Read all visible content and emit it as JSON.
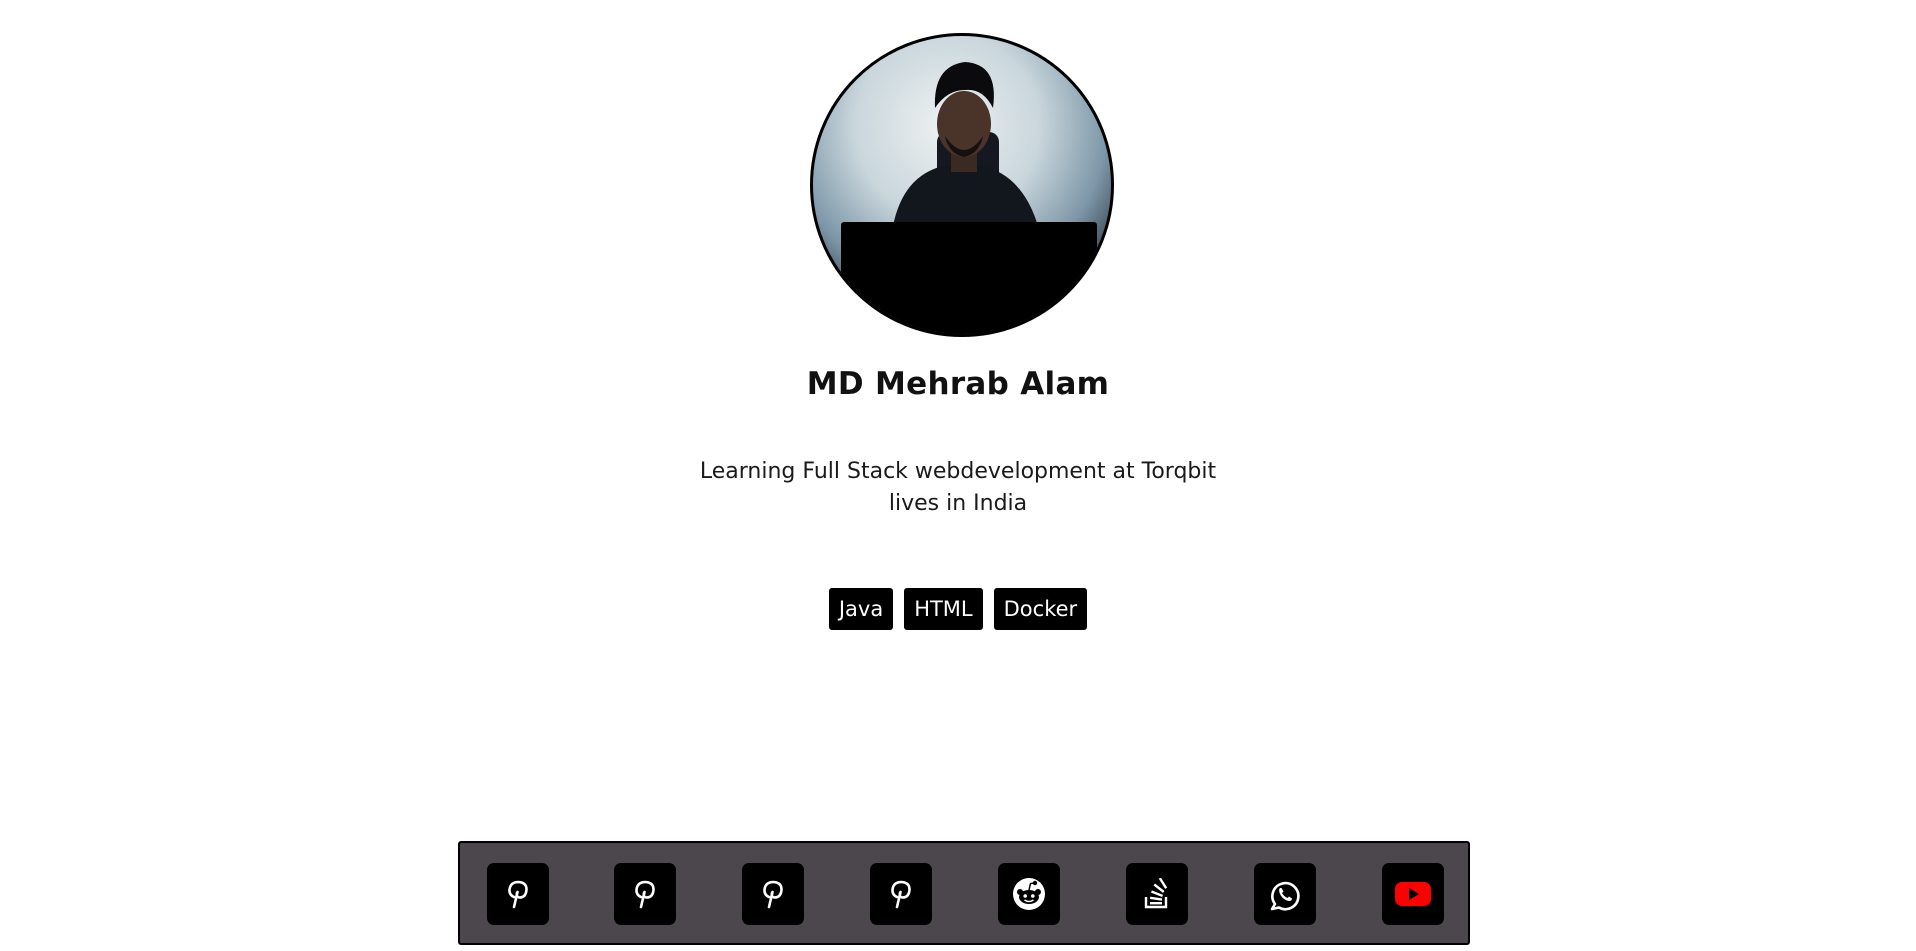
{
  "profile": {
    "name": "MD Mehrab Alam",
    "bio_line_1": "Learning Full Stack webdevelopment at Torqbit",
    "bio_line_2": "lives in India",
    "avatar": "profile-photo"
  },
  "skills": [
    "Java",
    "HTML",
    "Docker"
  ],
  "social_links": [
    {
      "icon": "pinterest-icon"
    },
    {
      "icon": "pinterest-icon"
    },
    {
      "icon": "pinterest-icon"
    },
    {
      "icon": "pinterest-icon"
    },
    {
      "icon": "reddit-icon"
    },
    {
      "icon": "stackoverflow-icon"
    },
    {
      "icon": "whatsapp-icon"
    },
    {
      "icon": "youtube-icon"
    }
  ],
  "colors": {
    "background": "#ffffff",
    "tag_background": "#000000",
    "tag_text": "#ffffff",
    "social_bar": "#4b474d",
    "youtube_red": "#ff0000"
  }
}
